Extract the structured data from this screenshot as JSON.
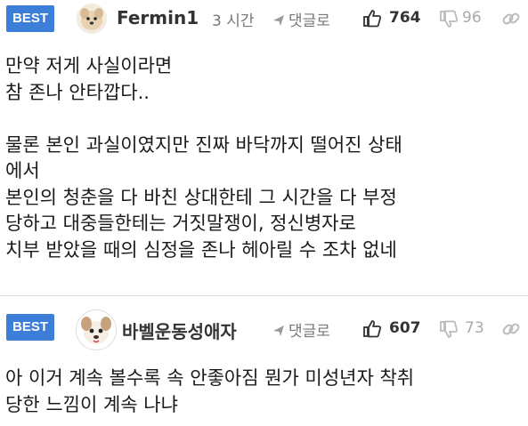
{
  "comments": [
    {
      "badge": "BEST",
      "username": "Fermin1",
      "time": "3 시간",
      "reply": "댓글로",
      "upvotes": "764",
      "downvotes": "96",
      "body": "만약 저게 사실이라면\n참 존나 안타깝다..\n\n물론 본인 과실이였지만 진짜 바닥까지 떨어진 상태\n에서\n본인의 청춘을 다 바친 상대한테 그 시간을 다 부정\n당하고 대중들한테는 거짓말쟁이, 정신병자로\n치부 받았을 때의 심정을 존나 헤아릴 수 조차 없네"
    },
    {
      "badge": "BEST",
      "username": "바벨운동성애자",
      "reply": "댓글로",
      "upvotes": "607",
      "downvotes": "73",
      "body": "아 이거 계속 볼수록 속 안좋아짐 뭔가 미성년자 착취\n당한 느낌이 계속 나냐"
    }
  ]
}
